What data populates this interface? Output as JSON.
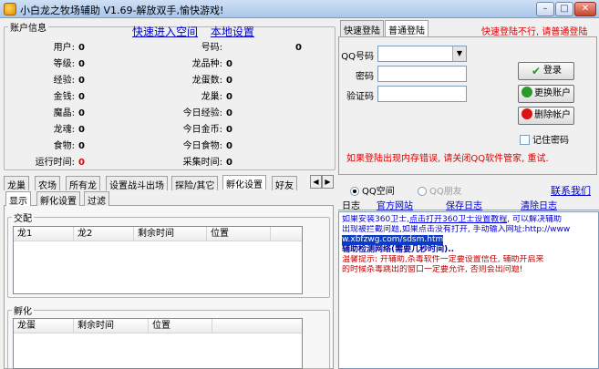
{
  "titlebar": {
    "title": "小白龙之牧场辅助 V1.69-解放双手,愉快游戏!",
    "min": "–",
    "max": "□",
    "close": "✕"
  },
  "account": {
    "legend": "账户信息",
    "link_quick": "快速进入空间",
    "link_local": "本地设置",
    "stats_left": [
      {
        "label": "用户:",
        "value": "0"
      },
      {
        "label": "等级:",
        "value": "0"
      },
      {
        "label": "经验:",
        "value": "0"
      },
      {
        "label": "金钱:",
        "value": "0"
      },
      {
        "label": "魔晶:",
        "value": "0"
      },
      {
        "label": "龙魂:",
        "value": "0"
      },
      {
        "label": "食物:",
        "value": "0"
      },
      {
        "label": "运行时间:",
        "value": "0"
      }
    ],
    "stats_right": [
      {
        "label": "号码:",
        "value": "0"
      },
      {
        "label": "龙品种:",
        "value": "0"
      },
      {
        "label": "龙蛋数:",
        "value": "0"
      },
      {
        "label": "龙巢:",
        "value": "0"
      },
      {
        "label": "今日经验:",
        "value": "0"
      },
      {
        "label": "今日金币:",
        "value": "0"
      },
      {
        "label": "今日食物:",
        "value": "0"
      },
      {
        "label": "采集时间:",
        "value": "0"
      }
    ]
  },
  "login": {
    "tab_quick": "快速登陆",
    "tab_normal": "普通登陆",
    "hint": "快速登陆不行, 请普通登陆",
    "qq_label": "QQ号码",
    "pwd_label": "密码",
    "code_label": "验证码",
    "btn_login": "登录",
    "btn_switch": "更换账户",
    "btn_delete": "删除帐户",
    "remember": "记住密码",
    "warning": "如果登陆出现内存错误, 请关闭QQ软件管家, 重试."
  },
  "tabs": {
    "main": [
      "龙巢",
      "农场",
      "所有龙",
      "设置战斗出场",
      "探险/其它",
      "孵化设置",
      "好友"
    ],
    "sub": [
      "显示",
      "孵化设置",
      "过滤"
    ],
    "arrow_left": "◀",
    "arrow_right": "▶"
  },
  "panel_jiaopei": {
    "legend": "交配",
    "columns": [
      "龙1",
      "龙2",
      "剩余时间",
      "位置"
    ]
  },
  "panel_fuhua": {
    "legend": "孵化",
    "columns": [
      "龙蛋",
      "剩余时间",
      "位置"
    ]
  },
  "right": {
    "radio_qzone": "QQ空间",
    "radio_friend": "QQ朋友",
    "contact": "联系我们",
    "log_tabs": [
      "日志",
      "官方网站",
      "保存日志",
      "清除日志"
    ]
  },
  "log": [
    {
      "text": "如果安装360卫士,",
      "link": "点击打开360卫士设置教程",
      "tail": ", 可以解决辅助"
    },
    {
      "text": "出现被拦截问题,如果点击没有打开, 手动输入网址:http://www"
    },
    {
      "text": "w.xbfzwg.com/sdsm.htm"
    },
    {
      "text": "辅助检测网络(需要几秒时间).."
    },
    {
      "text": "温馨提示: 开辅助,杀毒软件一定要设置信任, 辅助开启来"
    },
    {
      "text": "的时候杀毒跳出的窗口一定要允许, 否则会出问题!"
    }
  ],
  "colors": {
    "link": "#0000d0",
    "warning": "#e00000",
    "titlebar": "#a9c6ea"
  }
}
